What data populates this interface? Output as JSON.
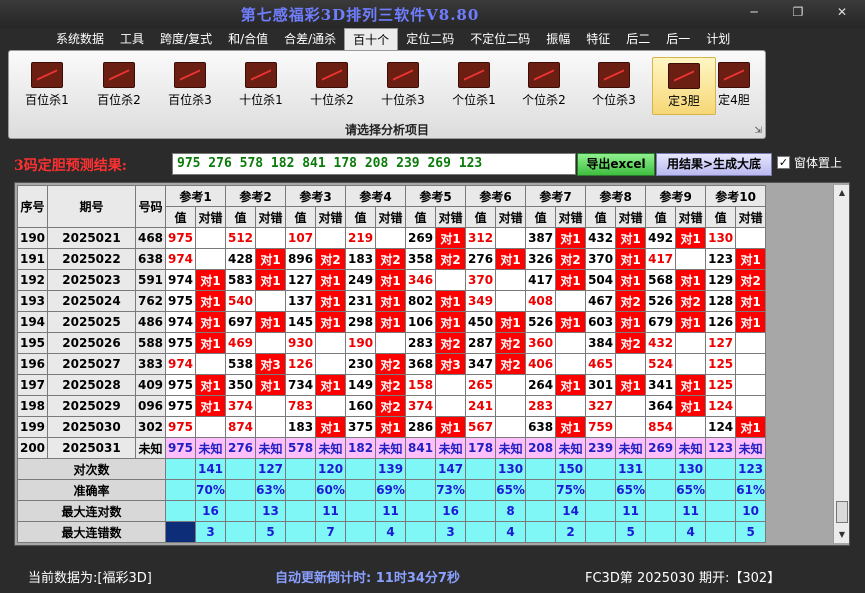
{
  "window": {
    "title": "第七感福彩3D排列三软件V8.80",
    "minimize_icon": "minimize-icon",
    "restore_icon": "restore-icon",
    "close_icon": "close-icon"
  },
  "menu": [
    {
      "label": "系统数据",
      "active": false
    },
    {
      "label": "工具",
      "active": false
    },
    {
      "label": "跨度/复式",
      "active": false
    },
    {
      "label": "和/合值",
      "active": false
    },
    {
      "label": "合差/通杀",
      "active": false
    },
    {
      "label": "百十个",
      "active": true
    },
    {
      "label": "定位二码",
      "active": false
    },
    {
      "label": "不定位二码",
      "active": false
    },
    {
      "label": "振幅",
      "active": false
    },
    {
      "label": "特征",
      "active": false
    },
    {
      "label": "后二",
      "active": false
    },
    {
      "label": "后一",
      "active": false
    },
    {
      "label": "计划",
      "active": false
    }
  ],
  "ribbon": {
    "caption": "请选择分析项目",
    "buttons": [
      {
        "label": "百位杀1",
        "active": false
      },
      {
        "label": "百位杀2",
        "active": false
      },
      {
        "label": "百位杀3",
        "active": false
      },
      {
        "label": "十位杀1",
        "active": false
      },
      {
        "label": "十位杀2",
        "active": false
      },
      {
        "label": "十位杀3",
        "active": false
      },
      {
        "label": "个位杀1",
        "active": false
      },
      {
        "label": "个位杀2",
        "active": false
      },
      {
        "label": "个位杀3",
        "active": false
      },
      {
        "label": "定3胆",
        "active": true
      },
      {
        "label": "定4胆",
        "active": false
      }
    ]
  },
  "prediction": {
    "label": "3码定胆预测结果:",
    "value": "975 276 578 182 841 178 208 239 269 123",
    "excel_button": "导出excel",
    "generate_button": "用结果>生成大底",
    "topmost_checked": true,
    "topmost_label": "窗体置上"
  },
  "grid": {
    "headers": {
      "seq": "序号",
      "issue": "期号",
      "code": "号码",
      "value": "值",
      "check": "对错"
    },
    "refs": [
      "参考1",
      "参考2",
      "参考3",
      "参考4",
      "参考5",
      "参考6",
      "参考7",
      "参考8",
      "参考9",
      "参考10"
    ],
    "rows": [
      {
        "seq": "190",
        "issue": "2025021",
        "code": "468",
        "cells": [
          {
            "v": "975",
            "r": true,
            "c": ""
          },
          {
            "v": "512",
            "r": true,
            "c": ""
          },
          {
            "v": "107",
            "r": true,
            "c": ""
          },
          {
            "v": "219",
            "r": true,
            "c": ""
          },
          {
            "v": "269",
            "r": false,
            "c": "对1"
          },
          {
            "v": "312",
            "r": true,
            "c": ""
          },
          {
            "v": "387",
            "r": false,
            "c": "对1"
          },
          {
            "v": "432",
            "r": false,
            "c": "对1"
          },
          {
            "v": "492",
            "r": false,
            "c": "对1"
          },
          {
            "v": "130",
            "r": true,
            "c": ""
          }
        ]
      },
      {
        "seq": "191",
        "issue": "2025022",
        "code": "638",
        "cells": [
          {
            "v": "974",
            "r": true,
            "c": ""
          },
          {
            "v": "428",
            "r": false,
            "c": "对1"
          },
          {
            "v": "896",
            "r": false,
            "c": "对2"
          },
          {
            "v": "183",
            "r": false,
            "c": "对2"
          },
          {
            "v": "358",
            "r": false,
            "c": "对2"
          },
          {
            "v": "276",
            "r": false,
            "c": "对1"
          },
          {
            "v": "326",
            "r": false,
            "c": "对2"
          },
          {
            "v": "370",
            "r": false,
            "c": "对1"
          },
          {
            "v": "417",
            "r": true,
            "c": ""
          },
          {
            "v": "123",
            "r": false,
            "c": "对1"
          }
        ]
      },
      {
        "seq": "192",
        "issue": "2025023",
        "code": "591",
        "cells": [
          {
            "v": "974",
            "r": false,
            "c": "对1"
          },
          {
            "v": "583",
            "r": false,
            "c": "对1"
          },
          {
            "v": "127",
            "r": false,
            "c": "对1"
          },
          {
            "v": "249",
            "r": false,
            "c": "对1"
          },
          {
            "v": "346",
            "r": true,
            "c": ""
          },
          {
            "v": "370",
            "r": true,
            "c": ""
          },
          {
            "v": "417",
            "r": false,
            "c": "对1"
          },
          {
            "v": "504",
            "r": false,
            "c": "对1"
          },
          {
            "v": "568",
            "r": false,
            "c": "对1"
          },
          {
            "v": "129",
            "r": false,
            "c": "对2"
          }
        ]
      },
      {
        "seq": "193",
        "issue": "2025024",
        "code": "762",
        "cells": [
          {
            "v": "975",
            "r": false,
            "c": "对1"
          },
          {
            "v": "540",
            "r": true,
            "c": ""
          },
          {
            "v": "137",
            "r": false,
            "c": "对1"
          },
          {
            "v": "231",
            "r": false,
            "c": "对1"
          },
          {
            "v": "802",
            "r": false,
            "c": "对1"
          },
          {
            "v": "349",
            "r": true,
            "c": ""
          },
          {
            "v": "408",
            "r": true,
            "c": ""
          },
          {
            "v": "467",
            "r": false,
            "c": "对2"
          },
          {
            "v": "526",
            "r": false,
            "c": "对2"
          },
          {
            "v": "128",
            "r": false,
            "c": "对1"
          }
        ]
      },
      {
        "seq": "194",
        "issue": "2025025",
        "code": "486",
        "cells": [
          {
            "v": "974",
            "r": false,
            "c": "对1"
          },
          {
            "v": "697",
            "r": false,
            "c": "对1"
          },
          {
            "v": "145",
            "r": false,
            "c": "对1"
          },
          {
            "v": "298",
            "r": false,
            "c": "对1"
          },
          {
            "v": "106",
            "r": false,
            "c": "对1"
          },
          {
            "v": "450",
            "r": false,
            "c": "对1"
          },
          {
            "v": "526",
            "r": false,
            "c": "对1"
          },
          {
            "v": "603",
            "r": false,
            "c": "对1"
          },
          {
            "v": "679",
            "r": false,
            "c": "对1"
          },
          {
            "v": "126",
            "r": false,
            "c": "对1"
          }
        ]
      },
      {
        "seq": "195",
        "issue": "2025026",
        "code": "588",
        "cells": [
          {
            "v": "975",
            "r": false,
            "c": "对1"
          },
          {
            "v": "469",
            "r": true,
            "c": ""
          },
          {
            "v": "930",
            "r": true,
            "c": ""
          },
          {
            "v": "190",
            "r": true,
            "c": ""
          },
          {
            "v": "283",
            "r": false,
            "c": "对2"
          },
          {
            "v": "287",
            "r": false,
            "c": "对2"
          },
          {
            "v": "360",
            "r": true,
            "c": ""
          },
          {
            "v": "384",
            "r": false,
            "c": "对2"
          },
          {
            "v": "432",
            "r": true,
            "c": ""
          },
          {
            "v": "127",
            "r": true,
            "c": ""
          }
        ]
      },
      {
        "seq": "196",
        "issue": "2025027",
        "code": "383",
        "cells": [
          {
            "v": "974",
            "r": true,
            "c": ""
          },
          {
            "v": "538",
            "r": false,
            "c": "对3"
          },
          {
            "v": "126",
            "r": true,
            "c": ""
          },
          {
            "v": "230",
            "r": false,
            "c": "对2"
          },
          {
            "v": "368",
            "r": false,
            "c": "对3"
          },
          {
            "v": "347",
            "r": false,
            "c": "对2"
          },
          {
            "v": "406",
            "r": true,
            "c": ""
          },
          {
            "v": "465",
            "r": true,
            "c": ""
          },
          {
            "v": "524",
            "r": true,
            "c": ""
          },
          {
            "v": "125",
            "r": true,
            "c": ""
          }
        ]
      },
      {
        "seq": "197",
        "issue": "2025028",
        "code": "409",
        "cells": [
          {
            "v": "975",
            "r": false,
            "c": "对1"
          },
          {
            "v": "350",
            "r": false,
            "c": "对1"
          },
          {
            "v": "734",
            "r": false,
            "c": "对1"
          },
          {
            "v": "149",
            "r": false,
            "c": "对2"
          },
          {
            "v": "158",
            "r": true,
            "c": ""
          },
          {
            "v": "265",
            "r": true,
            "c": ""
          },
          {
            "v": "264",
            "r": false,
            "c": "对1"
          },
          {
            "v": "301",
            "r": false,
            "c": "对1"
          },
          {
            "v": "341",
            "r": false,
            "c": "对1"
          },
          {
            "v": "125",
            "r": true,
            "c": ""
          }
        ]
      },
      {
        "seq": "198",
        "issue": "2025029",
        "code": "096",
        "cells": [
          {
            "v": "975",
            "r": false,
            "c": "对1"
          },
          {
            "v": "374",
            "r": true,
            "c": ""
          },
          {
            "v": "783",
            "r": true,
            "c": ""
          },
          {
            "v": "160",
            "r": false,
            "c": "对2"
          },
          {
            "v": "374",
            "r": true,
            "c": ""
          },
          {
            "v": "241",
            "r": true,
            "c": ""
          },
          {
            "v": "283",
            "r": true,
            "c": ""
          },
          {
            "v": "327",
            "r": true,
            "c": ""
          },
          {
            "v": "364",
            "r": false,
            "c": "对1"
          },
          {
            "v": "124",
            "r": true,
            "c": ""
          }
        ]
      },
      {
        "seq": "199",
        "issue": "2025030",
        "code": "302",
        "cells": [
          {
            "v": "975",
            "r": true,
            "c": ""
          },
          {
            "v": "874",
            "r": true,
            "c": ""
          },
          {
            "v": "183",
            "r": false,
            "c": "对1"
          },
          {
            "v": "375",
            "r": false,
            "c": "对1"
          },
          {
            "v": "286",
            "r": false,
            "c": "对1"
          },
          {
            "v": "567",
            "r": true,
            "c": ""
          },
          {
            "v": "638",
            "r": false,
            "c": "对1"
          },
          {
            "v": "759",
            "r": true,
            "c": ""
          },
          {
            "v": "854",
            "r": true,
            "c": ""
          },
          {
            "v": "124",
            "r": false,
            "c": "对1"
          }
        ]
      }
    ],
    "pending": {
      "seq": "200",
      "issue": "2025031",
      "code": "未知",
      "unknown": "未知",
      "values": [
        "975",
        "276",
        "578",
        "182",
        "841",
        "178",
        "208",
        "239",
        "269",
        "123"
      ]
    },
    "stats": [
      {
        "label": "对次数",
        "values": [
          "141",
          "127",
          "120",
          "139",
          "147",
          "130",
          "150",
          "131",
          "130",
          "123"
        ]
      },
      {
        "label": "准确率",
        "values": [
          "70%",
          "63%",
          "60%",
          "69%",
          "73%",
          "65%",
          "75%",
          "65%",
          "65%",
          "61%"
        ]
      },
      {
        "label": "最大连对数",
        "values": [
          "16",
          "13",
          "11",
          "11",
          "16",
          "8",
          "14",
          "11",
          "11",
          "10"
        ]
      },
      {
        "label": "最大连错数",
        "values": [
          "3",
          "5",
          "7",
          "4",
          "3",
          "4",
          "2",
          "5",
          "4",
          "5"
        ]
      }
    ]
  },
  "status": {
    "data_source": "当前数据为:[福彩3D]",
    "countdown": "自动更新倒计时: 11时34分7秒",
    "latest": "FC3D第 2025030 期开:【302】"
  }
}
